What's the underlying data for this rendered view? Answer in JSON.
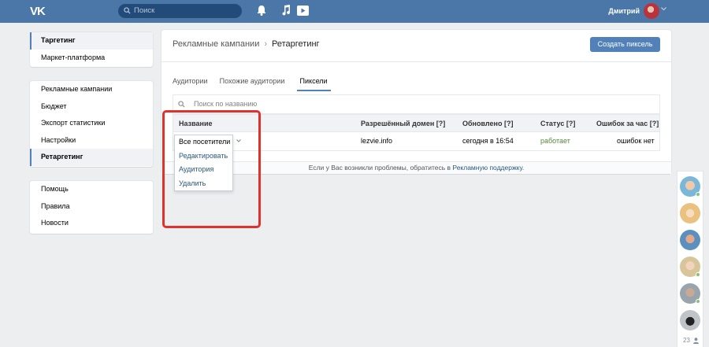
{
  "header": {
    "logo": "VK",
    "search_placeholder": "Поиск",
    "user_name": "Дмитрий"
  },
  "nav": {
    "group1": [
      {
        "label": "Таргетинг",
        "active": true
      },
      {
        "label": "Маркет-платформа"
      }
    ],
    "group2": [
      {
        "label": "Рекламные кампании"
      },
      {
        "label": "Бюджет"
      },
      {
        "label": "Экспорт статистики"
      },
      {
        "label": "Настройки"
      },
      {
        "label": "Ретаргетинг",
        "active": true
      }
    ],
    "group3": [
      {
        "label": "Помощь"
      },
      {
        "label": "Правила"
      },
      {
        "label": "Новости"
      }
    ]
  },
  "main": {
    "breadcrumb_parent": "Рекламные кампании",
    "breadcrumb_sep": "›",
    "breadcrumb_current": "Ретаргетинг",
    "create_button": "Создать пиксель",
    "tabs": [
      {
        "label": "Аудитории"
      },
      {
        "label": "Похожие аудитории"
      },
      {
        "label": "Пиксели",
        "active": true
      }
    ],
    "search_placeholder": "Поиск по названию",
    "columns": {
      "name": "Название",
      "domain": "Разрешённый домен [?]",
      "updated": "Обновлено [?]",
      "status": "Статус [?]",
      "errors": "Ошибок за час [?]"
    },
    "row": {
      "domain": "lezvie.info",
      "updated": "сегодня в 16:54",
      "status": "работает",
      "errors": "ошибок нет"
    },
    "footer_text": "Если у Вас возникли проблемы, обратитесь в",
    "footer_link": "Рекламную поддержку",
    "footer_end": "."
  },
  "dropdown": {
    "items": [
      "Все посетители",
      "Редактировать",
      "Аудитория",
      "Удалить"
    ]
  },
  "friends": {
    "count": "23"
  },
  "colors": {
    "topbar": "#4a76a8",
    "accent": "#5181b8",
    "highlight": "#e0312c",
    "status_ok": "#4f8a3b"
  }
}
